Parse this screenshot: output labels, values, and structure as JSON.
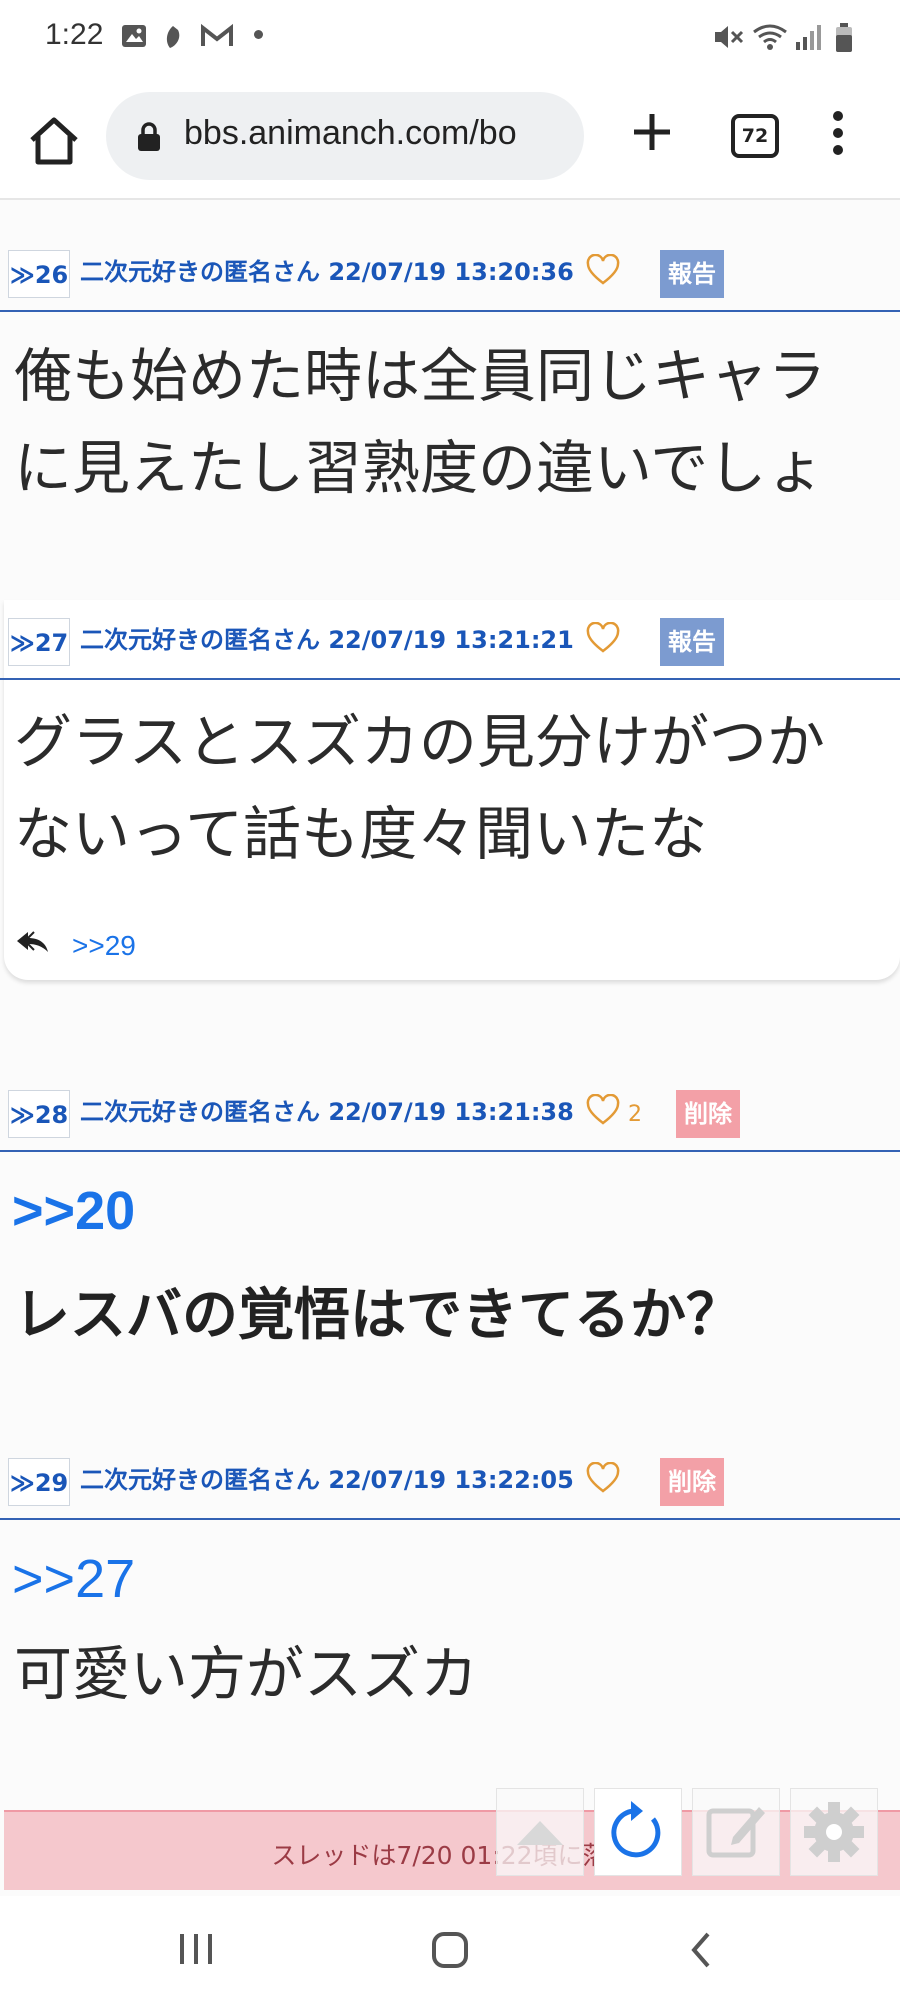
{
  "status_bar": {
    "time": "1:22"
  },
  "browser": {
    "url": "bbs.animanch.com/bo",
    "tab_count": "72"
  },
  "posts": [
    {
      "num": "≫26",
      "author_line": "二次元好きの匿名さん 22/07/19 13:20:36",
      "likes": "",
      "action": "報告",
      "lines": [
        "俺も始めた時は全員同じキャラ",
        "に見えたし習熟度の違いでしょ"
      ]
    },
    {
      "num": "≫27",
      "author_line": "二次元好きの匿名さん 22/07/19 13:21:21",
      "likes": "",
      "action": "報告",
      "lines": [
        "グラスとスズカの見分けがつか",
        "ないって話も度々聞いたな"
      ],
      "reply_link": ">>29"
    },
    {
      "num": "≫28",
      "author_line": "二次元好きの匿名さん 22/07/19 13:21:38",
      "likes": "2",
      "action": "削除",
      "anchor": ">>20",
      "bold_line": "レスバの覚悟はできてるか？"
    },
    {
      "num": "≫29",
      "author_line": "二次元好きの匿名さん 22/07/19 13:22:05",
      "likes": "",
      "action": "削除",
      "anchor": ">>27",
      "lines": [
        "可愛い方がスズカ"
      ]
    }
  ],
  "footer": {
    "notice": "スレッドは7/20 01:22頃に落ち"
  },
  "colors": {
    "link_blue": "#1a56b8",
    "report_badge": "#7c9bd0",
    "delete_badge": "#f3a0a7",
    "heart": "#e39a35",
    "notice_bg": "#f5c8cd"
  }
}
